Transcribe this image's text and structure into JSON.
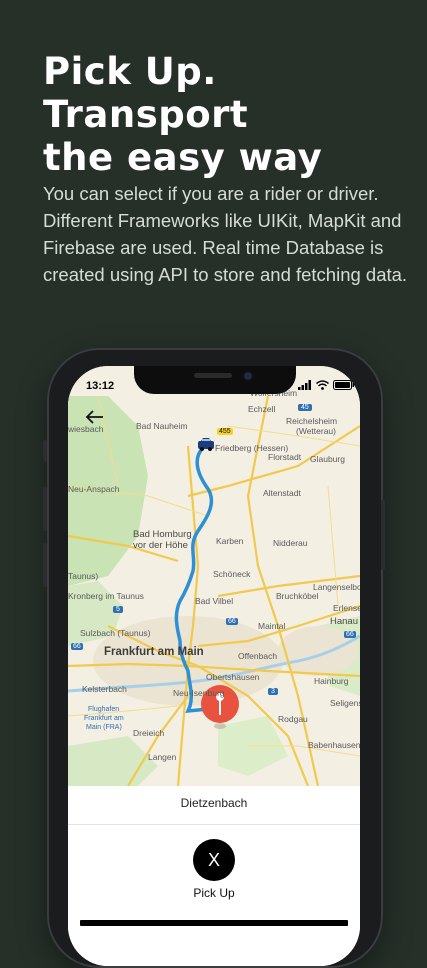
{
  "promo": {
    "headline": [
      "Pick Up.",
      "Transport",
      "the easy way"
    ],
    "description": "You can select if you are a rider or driver. Different Frameworks like UIKit, MapKit and Firebase are used. Real time Database is created using API to store and fetching data."
  },
  "status_bar": {
    "time": "13:12"
  },
  "map": {
    "labels": {
      "wolfersheim": "Wolfersheim",
      "echzell": "Echzell",
      "bad_nauheim": "Bad Nauheim",
      "reichelsheim": "Reichelsheim",
      "wetterau": "(Wetterau)",
      "friedberg": "Friedberg (Hessen)",
      "florstadt": "Florstadt",
      "glauburg": "Glauburg",
      "neu_anspach": "Neu-Anspach",
      "altenstadt": "Altenstadt",
      "bad_homburg_1": "Bad Homburg",
      "bad_homburg_2": "vor der Höhe",
      "karben": "Karben",
      "nidderau": "Nidderau",
      "taunus": "Taunus)",
      "schoeneck": "Schöneck",
      "langenselbold": "Langenselbol",
      "kronberg": "Kronberg im Taunus",
      "bad_vilbel": "Bad Vilbel",
      "bruchkoebel": "Bruchköbel",
      "erlensee": "Erlense",
      "sulzbach": "Sulzbach (Taunus)",
      "maintal": "Maintal",
      "hanau": "Hanau",
      "frankfurt": "Frankfurt am Main",
      "offenbach": "Offenbach",
      "obertshausen": "Obertshausen",
      "hainburg": "Hainburg",
      "kelsterbach": "Kelsterbach",
      "neu_isenburg": "Neu-Isenburg",
      "seligenstadt": "Seligens",
      "flughafen_1": "Flughafen",
      "flughafen_2": "Frankfurt am",
      "flughafen_3": "Main (FRA)",
      "rodgau": "Rodgau",
      "dreieich": "Dreieich",
      "langen": "Langen",
      "babenhausen": "Babenhausen",
      "wiesbach": "wiesbach"
    },
    "road_shields": {
      "a455": "455",
      "a45": "45",
      "a5": "5",
      "a66_1": "66",
      "a66_2": "66",
      "a3": "3",
      "a66_3": "66"
    }
  },
  "sheet": {
    "destination": "Dietzenbach",
    "close_button": "X",
    "pickup_label": "Pick Up"
  },
  "colors": {
    "background": "#263029",
    "route": "#2f8fd3",
    "pin": "#e8533f",
    "map_land": "#f3efe3",
    "map_green": "#c9e3b5"
  }
}
